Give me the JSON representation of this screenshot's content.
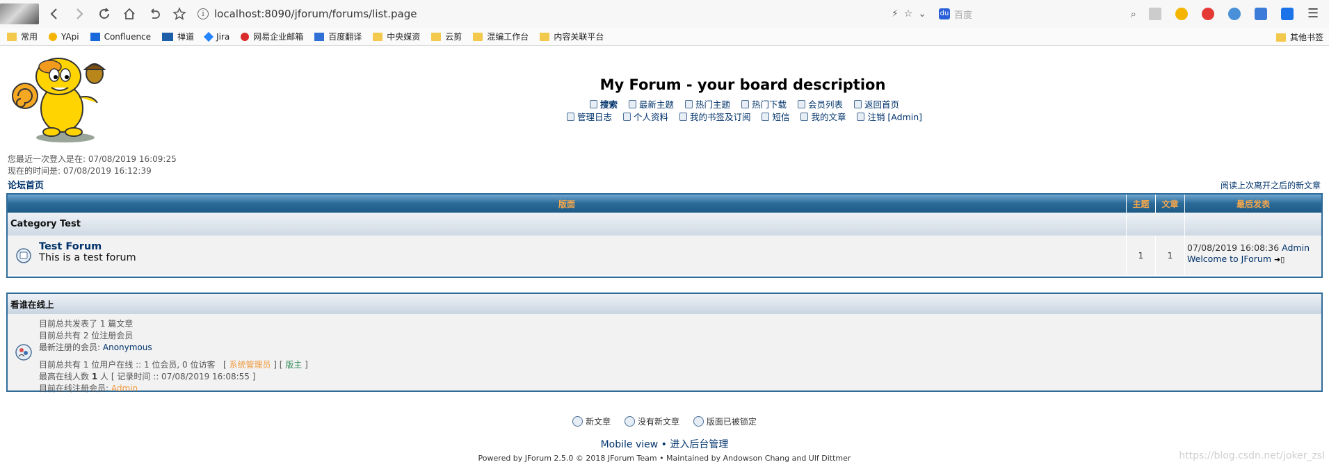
{
  "browser": {
    "url": "localhost:8090/jforum/forums/list.page",
    "search_placeholder": "百度",
    "bookmarks": [
      "常用",
      "YApi",
      "Confluence",
      "禅道",
      "Jira",
      "网易企业邮箱",
      "百度翻译",
      "中央媒资",
      "云剪",
      "混编工作台",
      "内容关联平台"
    ],
    "bookmarks_other": "其他书签"
  },
  "header": {
    "title": "My Forum - your board description",
    "menu_row1": [
      "搜索",
      "最新主题",
      "热门主题",
      "热门下载",
      "会员列表",
      "返回首页"
    ],
    "menu_row2": [
      "管理日志",
      "个人资料",
      "我的书签及订阅",
      "短信",
      "我的文章",
      "注销 [Admin]"
    ]
  },
  "visit": {
    "last_login": "您最近一次登入是在: 07/08/2019 16:09:25",
    "current_time": "现在的时间是: 07/08/2019 16:12:39"
  },
  "breadcrumb": "论坛首页",
  "new_since_last": "阅读上次离开之后的新文章",
  "forum_table": {
    "headers": [
      "版面",
      "主题",
      "文章",
      "最后发表"
    ],
    "category": "Category Test",
    "forums": [
      {
        "name": "Test Forum",
        "description": "This is a test forum",
        "topics": "1",
        "posts": "1",
        "last_post_time": "07/08/2019 16:08:36",
        "last_post_user": "Admin",
        "last_post_title": "Welcome to JForum"
      }
    ]
  },
  "online": {
    "title": "看谁在线上",
    "total_posts": "目前总共发表了 1 篇文章",
    "total_users": "目前总共有 2 位注册会员",
    "newest_label": "最新注册的会员:",
    "newest_user": "Anonymous",
    "online_now": "目前总共有 1 位用户在线 :: 1 位会员, 0 位访客",
    "admin_label": "系统管理员",
    "mod_label": "版主",
    "max_online_prefix": "最高在线人数",
    "max_online_count": "1",
    "max_online_suffix": "人 [ 记录时间 :: 07/08/2019 16:08:55 ]",
    "registered_online_label": "目前在线注册会员:",
    "registered_online_user": "Admin"
  },
  "legend": [
    "新文章",
    "没有新文章",
    "版面已被锁定"
  ],
  "footer": {
    "mobile": "Mobile view",
    "admin": "进入后台管理",
    "powered": "Powered by JForum 2.5.0 © 2018 JForum Team • Maintained by Andowson Chang and Ulf Dittmer",
    "watermark": "https://blog.csdn.net/joker_zsl"
  }
}
